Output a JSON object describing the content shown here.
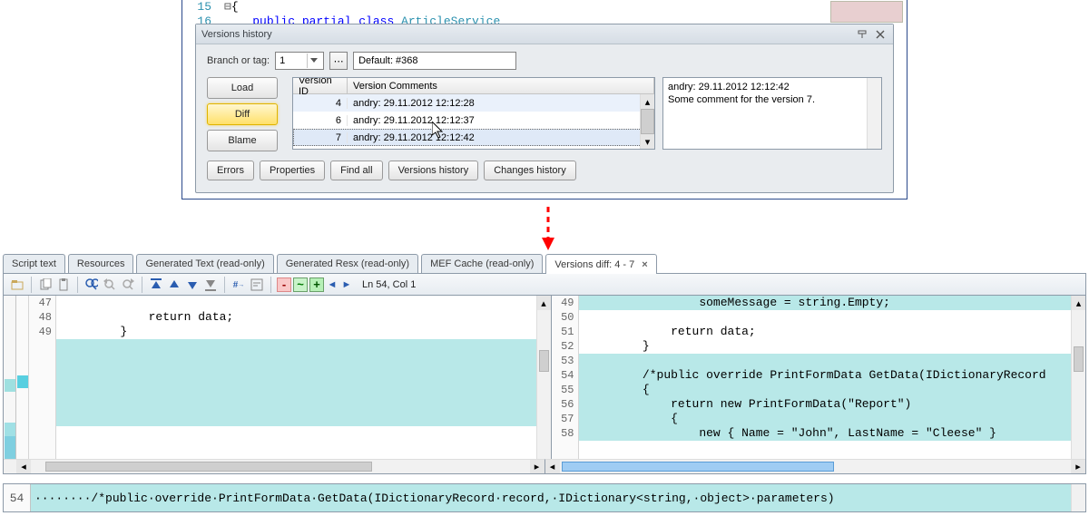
{
  "top_code": {
    "gutters": [
      "15",
      "16"
    ],
    "line15": "{",
    "line16_pre": "    ",
    "line16_kw": "public partial class ",
    "line16_typ": "ArticleService"
  },
  "versions_panel": {
    "title": "Versions history",
    "branch_label": "Branch or tag:",
    "branch_value": "1",
    "default_label": "Default: #368",
    "buttons": {
      "load": "Load",
      "diff": "Diff",
      "blame": "Blame"
    },
    "table": {
      "headers": {
        "id": "Version ID",
        "comments": "Version Comments"
      },
      "rows": [
        {
          "id": "4",
          "comments": "andry: 29.11.2012 12:12:28"
        },
        {
          "id": "6",
          "comments": "andry: 29.11.2012 12:12:37"
        },
        {
          "id": "7",
          "comments": "andry: 29.11.2012 12:12:42"
        }
      ]
    },
    "comment_header": "andry: 29.11.2012 12:12:42",
    "comment_body": "Some comment for the version 7.",
    "bottom_bar": {
      "errors": "Errors",
      "properties": "Properties",
      "find_all": "Find all",
      "versions_history": "Versions history",
      "changes_history": "Changes history"
    }
  },
  "tabs": {
    "script_text": "Script text",
    "resources": "Resources",
    "gen_text": "Generated Text (read-only)",
    "gen_resx": "Generated Resx (read-only)",
    "mef_cache": "MEF Cache (read-only)",
    "diff": "Versions diff: 4 - 7"
  },
  "toolbar": {
    "position": "Ln 54, Col 1",
    "icons": {
      "open": "open-icon",
      "copy": "copy-icon",
      "paste": "paste-icon",
      "find": "find-icon",
      "find_prev": "find-prev-icon",
      "find_next": "find-next-icon",
      "top": "nav-top-icon",
      "up": "nav-up-icon",
      "down": "nav-down-icon",
      "bottom": "nav-bottom-icon",
      "num": "line-number-icon",
      "wrap": "wrap-icon",
      "minus": "-",
      "tilde": "~",
      "plus": "+",
      "prev_change": "◄",
      "next_change": "►"
    }
  },
  "diff": {
    "left": {
      "gutters": [
        "47",
        "48",
        "49",
        "",
        "",
        "",
        "",
        "",
        ""
      ],
      "lines": [
        {
          "text": "",
          "fill": false
        },
        {
          "text": "            return data;",
          "fill": false
        },
        {
          "text": "        }",
          "fill": false
        },
        {
          "text": "",
          "fill": true
        },
        {
          "text": "",
          "fill": true
        },
        {
          "text": "",
          "fill": true
        },
        {
          "text": "",
          "fill": true
        },
        {
          "text": "",
          "fill": true
        },
        {
          "text": "",
          "fill": true
        }
      ]
    },
    "right": {
      "gutters": [
        "49",
        "50",
        "51",
        "52",
        "53",
        "54",
        "55",
        "56",
        "57",
        "58"
      ],
      "lines": [
        {
          "text": "                someMessage = string.Empty;",
          "fill": true
        },
        {
          "text": "",
          "fill": false
        },
        {
          "text": "            return data;",
          "fill": false
        },
        {
          "text": "        }",
          "fill": false
        },
        {
          "text": "",
          "fill": true
        },
        {
          "text": "        /*public override PrintFormData GetData(IDictionaryRecord",
          "fill": true
        },
        {
          "text": "        {",
          "fill": true
        },
        {
          "text": "            return new PrintFormData(\"Report\")",
          "fill": true
        },
        {
          "text": "            {",
          "fill": true
        },
        {
          "text": "                new { Name = \"John\", LastName = \"Cleese\" }",
          "fill": true
        }
      ]
    }
  },
  "bottomline": {
    "num": "54",
    "text": "········/*public·override·PrintFormData·GetData(IDictionaryRecord·record,·IDictionary<string,·object>·parameters)"
  }
}
